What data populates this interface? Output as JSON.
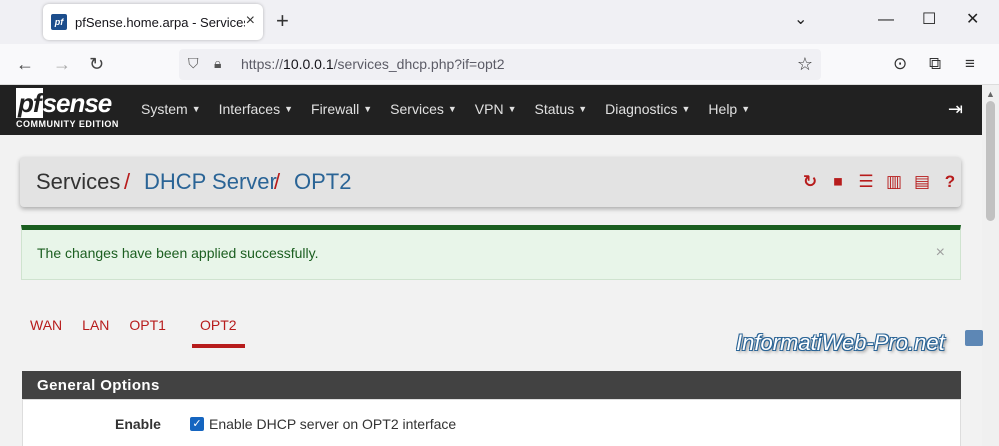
{
  "browser": {
    "tab_title": "pfSense.home.arpa - Services: D",
    "favicon_text": "pf",
    "url_prefix": "https://",
    "url_host": "10.0.0.1",
    "url_path": "/services_dhcp.php?if=opt2",
    "icons": [
      "back-arrow",
      "forward-arrow",
      "reload",
      "shield",
      "lock",
      "star",
      "pocket",
      "extensions",
      "menu"
    ]
  },
  "pfsense": {
    "logo_main": "sense",
    "logo_pf": "pf",
    "logo_sub": "COMMUNITY EDITION",
    "menu": [
      "System",
      "Interfaces",
      "Firewall",
      "Services",
      "VPN",
      "Status",
      "Diagnostics",
      "Help"
    ],
    "breadcrumb": {
      "part1": "Services",
      "part2": "DHCP Server",
      "part3": "OPT2",
      "sep": "/"
    },
    "alert": "The changes have been applied successfully.",
    "alert_close": "×",
    "tabs": [
      "WAN",
      "LAN",
      "OPT1",
      "OPT2"
    ],
    "active_tab": "OPT2",
    "panel_title": "General Options",
    "enable_label": "Enable",
    "enable_checkbox_label": "Enable DHCP server on OPT2 interface",
    "enable_checked": true
  },
  "watermark": "InformatiWeb-Pro.net",
  "colors": {
    "accent": "#b71c1c",
    "link": "#2a6496",
    "nav_bg": "#212121",
    "success": "#1b5e20"
  }
}
